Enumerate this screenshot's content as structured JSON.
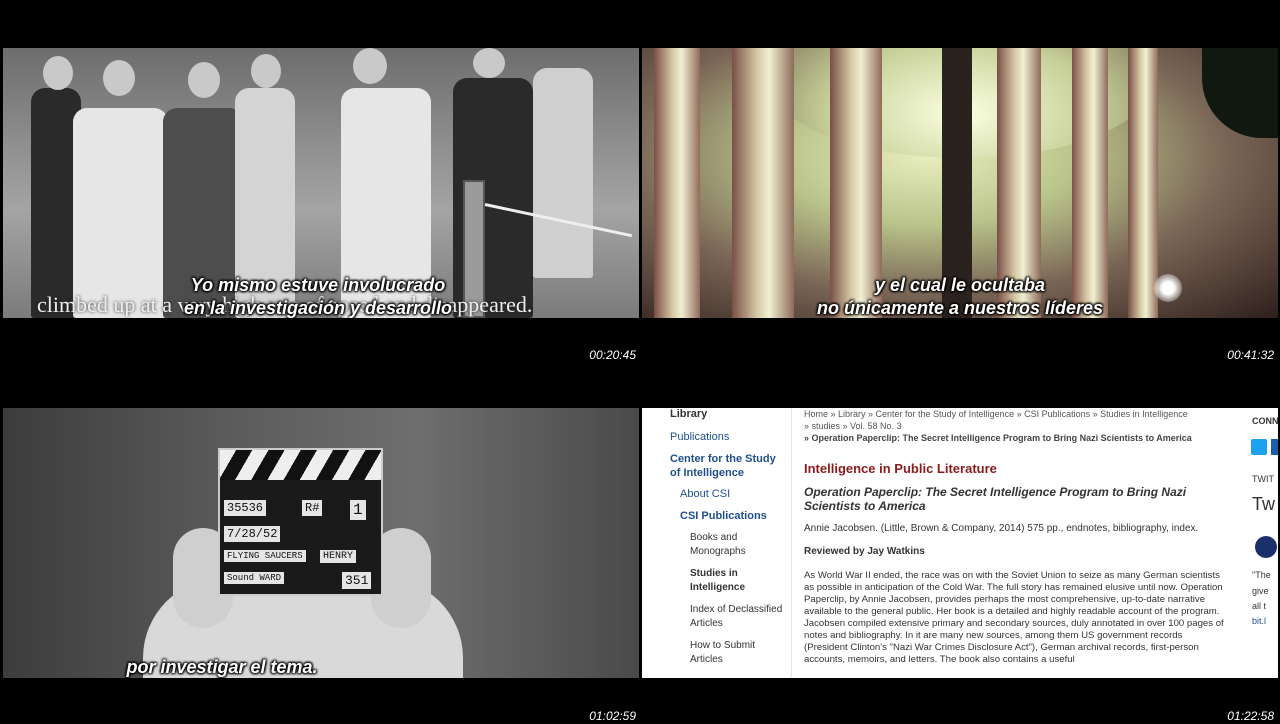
{
  "frames": [
    {
      "subtitle_lines": [
        "Yo mismo estuve involucrado",
        "en la investigación y desarrollo"
      ],
      "caption_text": "climbed up at a very high rate of speed and disappeared.",
      "timestamp": "00:20:45"
    },
    {
      "subtitle_lines": [
        "y el cual le ocultaba",
        "no únicamente a nuestros líderes"
      ],
      "timestamp": "00:41:32"
    },
    {
      "subtitle_lines": [
        "por investigar el tema."
      ],
      "slate": {
        "scene": "35536",
        "roll": "R#",
        "take": "1",
        "date": "7/28/52",
        "prod": "FLYING SAUCERS",
        "director": "HENRY",
        "sound": "Sound WARD",
        "camera": "351"
      },
      "timestamp": "01:02:59"
    },
    {
      "timestamp": "01:22:58",
      "sidebar": {
        "library": "Library",
        "publications": "Publications",
        "center": "Center for the Study of Intelligence",
        "about": "About CSI",
        "csi_pubs": "CSI Publications",
        "books": "Books and Monographs",
        "studies": "Studies in Intelligence",
        "index": "Index of Declassified Articles",
        "submit": "How to Submit Articles"
      },
      "breadcrumbs": {
        "line1": "Home  »  Library  »  Center for the Study of Intelligence  »  CSI Publications  »  Studies in Intelligence",
        "line2": "»  studies  »  Vol. 58 No. 3",
        "line3": "»  Operation Paperclip: The Secret Intelligence Program to Bring Nazi Scientists to America"
      },
      "heading": "Intelligence in Public Literature",
      "article_title": "Operation Paperclip: The Secret Intelligence Program to Bring Nazi Scientists to America",
      "citation": "Annie Jacobsen. (Little, Brown & Company, 2014) 575 pp., endnotes, bibliography, index.",
      "reviewer": "Reviewed by Jay Watkins",
      "body_text": "As World War II ended, the race was on with the Soviet Union to seize as many German scientists as possible in anticipation of the Cold War. The full story has remained elusive until now. Operation Paperclip, by Annie Jacobsen, provides perhaps the most comprehensive, up-to-date narrative available to the general public. Her book is a detailed and highly readable account of the program. Jacobsen compiled extensive primary and secondary sources, duly annotated in over 100 pages of notes and bibliography. In it are many new sources, among them US government records (President Clinton's \"Nazi War Crimes Disclosure Act\"), German archival records, first-person accounts, memoirs, and letters. The book also contains a useful",
      "right_column": {
        "connect": "CONN",
        "twitter": "TWIT",
        "tw": "Tw",
        "quote1": "\"The",
        "quote2": "give",
        "quote3": "all t",
        "link": "bit.l"
      }
    }
  ]
}
